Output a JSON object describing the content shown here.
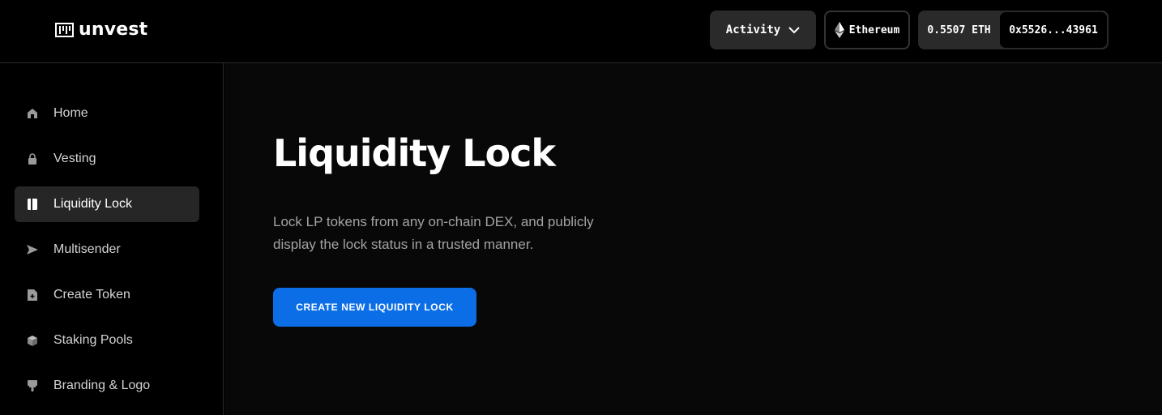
{
  "brand": {
    "name": "unvest"
  },
  "header": {
    "activity_label": "Activity",
    "network_label": "Ethereum",
    "balance": "0.5507 ETH",
    "address": "0x5526...43961"
  },
  "sidebar": {
    "items": [
      {
        "label": "Home",
        "icon": "home-icon"
      },
      {
        "label": "Vesting",
        "icon": "lock-icon"
      },
      {
        "label": "Liquidity Lock",
        "icon": "liquidity-lock-icon",
        "active": true
      },
      {
        "label": "Multisender",
        "icon": "send-icon"
      },
      {
        "label": "Create Token",
        "icon": "create-token-icon"
      },
      {
        "label": "Staking Pools",
        "icon": "staking-cube-icon"
      },
      {
        "label": "Branding & Logo",
        "icon": "brush-icon"
      }
    ]
  },
  "main": {
    "title": "Liquidity Lock",
    "description": "Lock LP tokens from any on-chain DEX, and publicly display the lock status in a trusted manner.",
    "cta_label": "CREATE NEW LIQUIDITY LOCK"
  },
  "colors": {
    "accent": "#0b6ee6",
    "background": "#000000",
    "panel": "#2a2a2a"
  }
}
